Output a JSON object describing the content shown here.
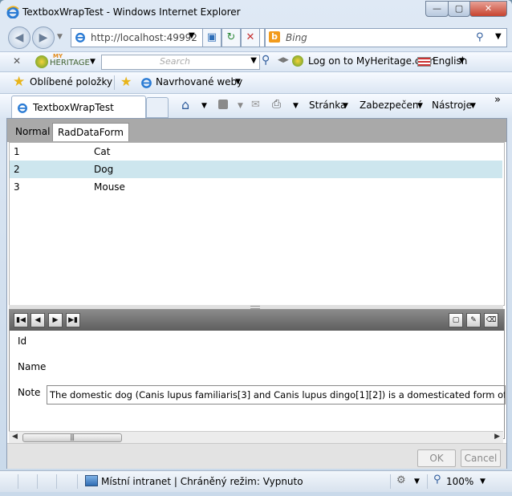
{
  "window": {
    "title": "TextboxWrapTest - Windows Internet Explorer",
    "minimize_glyph": "—",
    "maximize_glyph": "▢",
    "close_glyph": "✕"
  },
  "address_bar": {
    "url": "http://localhost:49992",
    "search_placeholder": "Bing"
  },
  "myheritage_bar": {
    "close_glyph": "✕",
    "logo_top": "MY",
    "logo_text": "HERITAGE",
    "search_placeholder": "Search",
    "logon_text": "Log on to MyHeritage.com",
    "language": "English"
  },
  "favorites_bar": {
    "favorites_label": "Oblíbené položky",
    "suggested_label": "Navrhované weby"
  },
  "tab_bar": {
    "tab_label": "TextboxWrapTest",
    "menu_page": "Stránka",
    "menu_security": "Zabezpečení",
    "menu_tools": "Nástroje",
    "overflow_glyph": "»"
  },
  "app": {
    "tabs": [
      "Normal",
      "RadDataForm"
    ],
    "selected_tab": "RadDataForm",
    "rows": [
      {
        "id": "1",
        "name": "Cat"
      },
      {
        "id": "2",
        "name": "Dog"
      },
      {
        "id": "3",
        "name": "Mouse"
      }
    ],
    "selected_row_id": "2",
    "form": {
      "id_label": "Id",
      "name_label": "Name",
      "note_label": "Note",
      "note_value": "The domestic dog (Canis lupus familiaris[3] and Canis lupus dingo[1][2]) is a domesticated form of the gray wolf"
    },
    "ok_label": "OK",
    "cancel_label": "Cancel"
  },
  "status_bar": {
    "zone_text": "Místní intranet | Chráněný režim: Vypnuto",
    "zoom": "100%"
  },
  "colors": {
    "selected_row": "#cde6ee",
    "tab_strip": "#a9a9a9",
    "form_toolbar": "#6f6f6f"
  }
}
